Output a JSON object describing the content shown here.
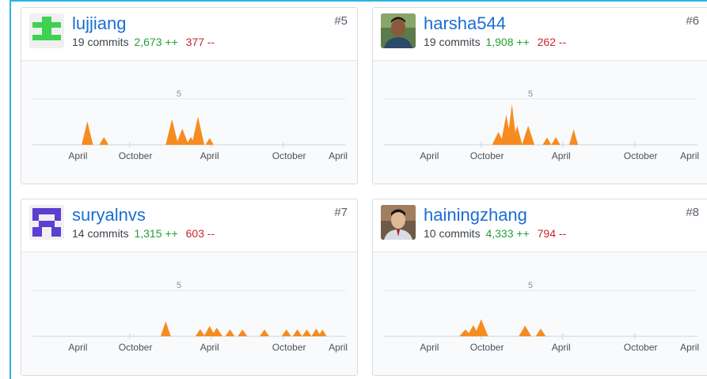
{
  "colors": {
    "accent": "#1a6ed3",
    "additions": "#23a036",
    "deletions": "#cb2431",
    "area": "#f68b1f"
  },
  "contributors": [
    {
      "name": "lujjiang",
      "rank": "#5",
      "commits": "19 commits",
      "additions": "2,673 ++",
      "deletions": "377 --",
      "avatar": "green-identicon",
      "gridline_label": "5",
      "x_labels": [
        "April",
        "October",
        "April",
        "October",
        "April"
      ],
      "peaks": [
        {
          "x": 0.175,
          "h": 0.55,
          "w": 0.018
        },
        {
          "x": 0.228,
          "h": 0.18,
          "w": 0.015
        },
        {
          "x": 0.445,
          "h": 0.6,
          "w": 0.02
        },
        {
          "x": 0.478,
          "h": 0.38,
          "w": 0.02
        },
        {
          "x": 0.505,
          "h": 0.18,
          "w": 0.015
        },
        {
          "x": 0.528,
          "h": 0.66,
          "w": 0.02
        },
        {
          "x": 0.565,
          "h": 0.16,
          "w": 0.013
        }
      ]
    },
    {
      "name": "harsha544",
      "rank": "#6",
      "commits": "19 commits",
      "additions": "1,908 ++",
      "deletions": "262 --",
      "avatar": "user-photo",
      "gridline_label": "5",
      "x_labels": [
        "April",
        "October",
        "April",
        "October",
        "April"
      ],
      "peaks": [
        {
          "x": 0.365,
          "h": 0.3,
          "w": 0.02
        },
        {
          "x": 0.39,
          "h": 0.7,
          "w": 0.018
        },
        {
          "x": 0.408,
          "h": 0.95,
          "w": 0.016
        },
        {
          "x": 0.425,
          "h": 0.45,
          "w": 0.016
        },
        {
          "x": 0.46,
          "h": 0.45,
          "w": 0.02
        },
        {
          "x": 0.52,
          "h": 0.17,
          "w": 0.014
        },
        {
          "x": 0.548,
          "h": 0.18,
          "w": 0.014
        },
        {
          "x": 0.605,
          "h": 0.36,
          "w": 0.014
        }
      ]
    },
    {
      "name": "suryalnvs",
      "rank": "#7",
      "commits": "14 commits",
      "additions": "1,315 ++",
      "deletions": "603 --",
      "avatar": "purple-identicon",
      "gridline_label": "5",
      "x_labels": [
        "April",
        "October",
        "April",
        "October",
        "April"
      ],
      "peaks": [
        {
          "x": 0.425,
          "h": 0.35,
          "w": 0.016
        },
        {
          "x": 0.535,
          "h": 0.17,
          "w": 0.015
        },
        {
          "x": 0.565,
          "h": 0.24,
          "w": 0.018
        },
        {
          "x": 0.588,
          "h": 0.2,
          "w": 0.018
        },
        {
          "x": 0.63,
          "h": 0.16,
          "w": 0.015
        },
        {
          "x": 0.67,
          "h": 0.16,
          "w": 0.015
        },
        {
          "x": 0.74,
          "h": 0.16,
          "w": 0.015
        },
        {
          "x": 0.81,
          "h": 0.16,
          "w": 0.015
        },
        {
          "x": 0.845,
          "h": 0.16,
          "w": 0.015
        },
        {
          "x": 0.875,
          "h": 0.16,
          "w": 0.015
        },
        {
          "x": 0.905,
          "h": 0.18,
          "w": 0.015
        },
        {
          "x": 0.925,
          "h": 0.16,
          "w": 0.013
        }
      ]
    },
    {
      "name": "hainingzhang",
      "rank": "#8",
      "commits": "10 commits",
      "additions": "4,333 ++",
      "deletions": "794 --",
      "avatar": "user-photo",
      "gridline_label": "5",
      "x_labels": [
        "April",
        "October",
        "April",
        "October",
        "April"
      ],
      "peaks": [
        {
          "x": 0.26,
          "h": 0.16,
          "w": 0.02
        },
        {
          "x": 0.285,
          "h": 0.26,
          "w": 0.02
        },
        {
          "x": 0.31,
          "h": 0.4,
          "w": 0.022
        },
        {
          "x": 0.45,
          "h": 0.25,
          "w": 0.02
        },
        {
          "x": 0.5,
          "h": 0.18,
          "w": 0.016
        }
      ]
    }
  ]
}
